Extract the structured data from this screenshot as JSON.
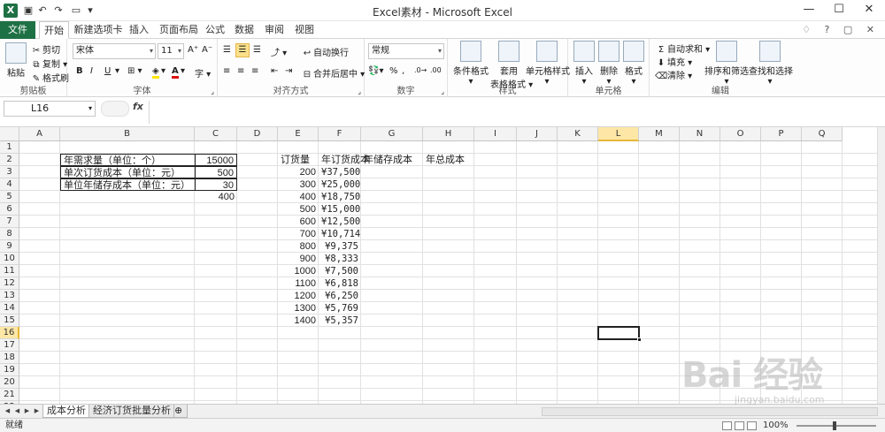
{
  "window": {
    "title": "Excel素材 - Microsoft Excel",
    "app_icon": "X"
  },
  "ribbon_tabs": [
    "文件",
    "开始",
    "新建选项卡",
    "插入",
    "页面布局",
    "公式",
    "数据",
    "审阅",
    "视图"
  ],
  "ribbon": {
    "clipboard": {
      "paste": "粘贴",
      "cut": "剪切",
      "copy": "复制",
      "format_painter": "格式刷",
      "label": "剪贴板"
    },
    "font": {
      "name": "宋体",
      "size": "11",
      "bold": "B",
      "italic": "I",
      "underline": "U",
      "label": "字体"
    },
    "alignment": {
      "wrap": "自动换行",
      "merge": "合并后居中",
      "label": "对齐方式"
    },
    "number": {
      "format": "常规",
      "label": "数字"
    },
    "styles": {
      "conditional": "条件格式",
      "table_format_1": "套用",
      "table_format_2": "表格格式",
      "cell_styles": "单元格样式",
      "label": "样式"
    },
    "cells": {
      "insert": "插入",
      "delete": "删除",
      "format": "格式",
      "label": "单元格"
    },
    "editing": {
      "autosum": "自动求和",
      "fill": "填充",
      "clear": "清除",
      "sort": "排序和筛选",
      "find": "查找和选择",
      "label": "编辑"
    }
  },
  "formula_bar": {
    "name_box": "L16",
    "fx": "fx",
    "formula": ""
  },
  "columns": [
    "A",
    "B",
    "C",
    "D",
    "E",
    "F",
    "G",
    "H",
    "I",
    "J",
    "K",
    "L",
    "M",
    "N",
    "O",
    "P",
    "Q"
  ],
  "active_column": "L",
  "rows": [
    "1",
    "2",
    "3",
    "4",
    "5",
    "6",
    "7",
    "8",
    "9",
    "10",
    "11",
    "12",
    "13",
    "14",
    "15",
    "16",
    "17",
    "18",
    "19",
    "20",
    "21",
    "22"
  ],
  "active_row": "16",
  "params": [
    {
      "label": "年需求量（单位：个）",
      "value": "15000"
    },
    {
      "label": "单次订货成本（单位：元）",
      "value": "500"
    },
    {
      "label": "单位年储存成本（单位：元）",
      "value": "30"
    }
  ],
  "c5_value": "400",
  "table_headers": {
    "e": "订货量",
    "f": "年订货成本",
    "g": "年储存成本",
    "h": "年总成本"
  },
  "table_rows": [
    {
      "qty": "200",
      "cost": "¥37,500"
    },
    {
      "qty": "300",
      "cost": "¥25,000"
    },
    {
      "qty": "400",
      "cost": "¥18,750"
    },
    {
      "qty": "500",
      "cost": "¥15,000"
    },
    {
      "qty": "600",
      "cost": "¥12,500"
    },
    {
      "qty": "700",
      "cost": "¥10,714"
    },
    {
      "qty": "800",
      "cost": "¥9,375"
    },
    {
      "qty": "900",
      "cost": "¥8,333"
    },
    {
      "qty": "1000",
      "cost": "¥7,500"
    },
    {
      "qty": "1100",
      "cost": "¥6,818"
    },
    {
      "qty": "1200",
      "cost": "¥6,250"
    },
    {
      "qty": "1300",
      "cost": "¥5,769"
    },
    {
      "qty": "1400",
      "cost": "¥5,357"
    }
  ],
  "sheet_tabs": [
    "成本分析",
    "经济订货批量分析"
  ],
  "status": {
    "ready": "就绪",
    "zoom": "100%"
  },
  "watermark": {
    "brand": "Bai  经验",
    "url": "jingyan.baidu.com"
  }
}
